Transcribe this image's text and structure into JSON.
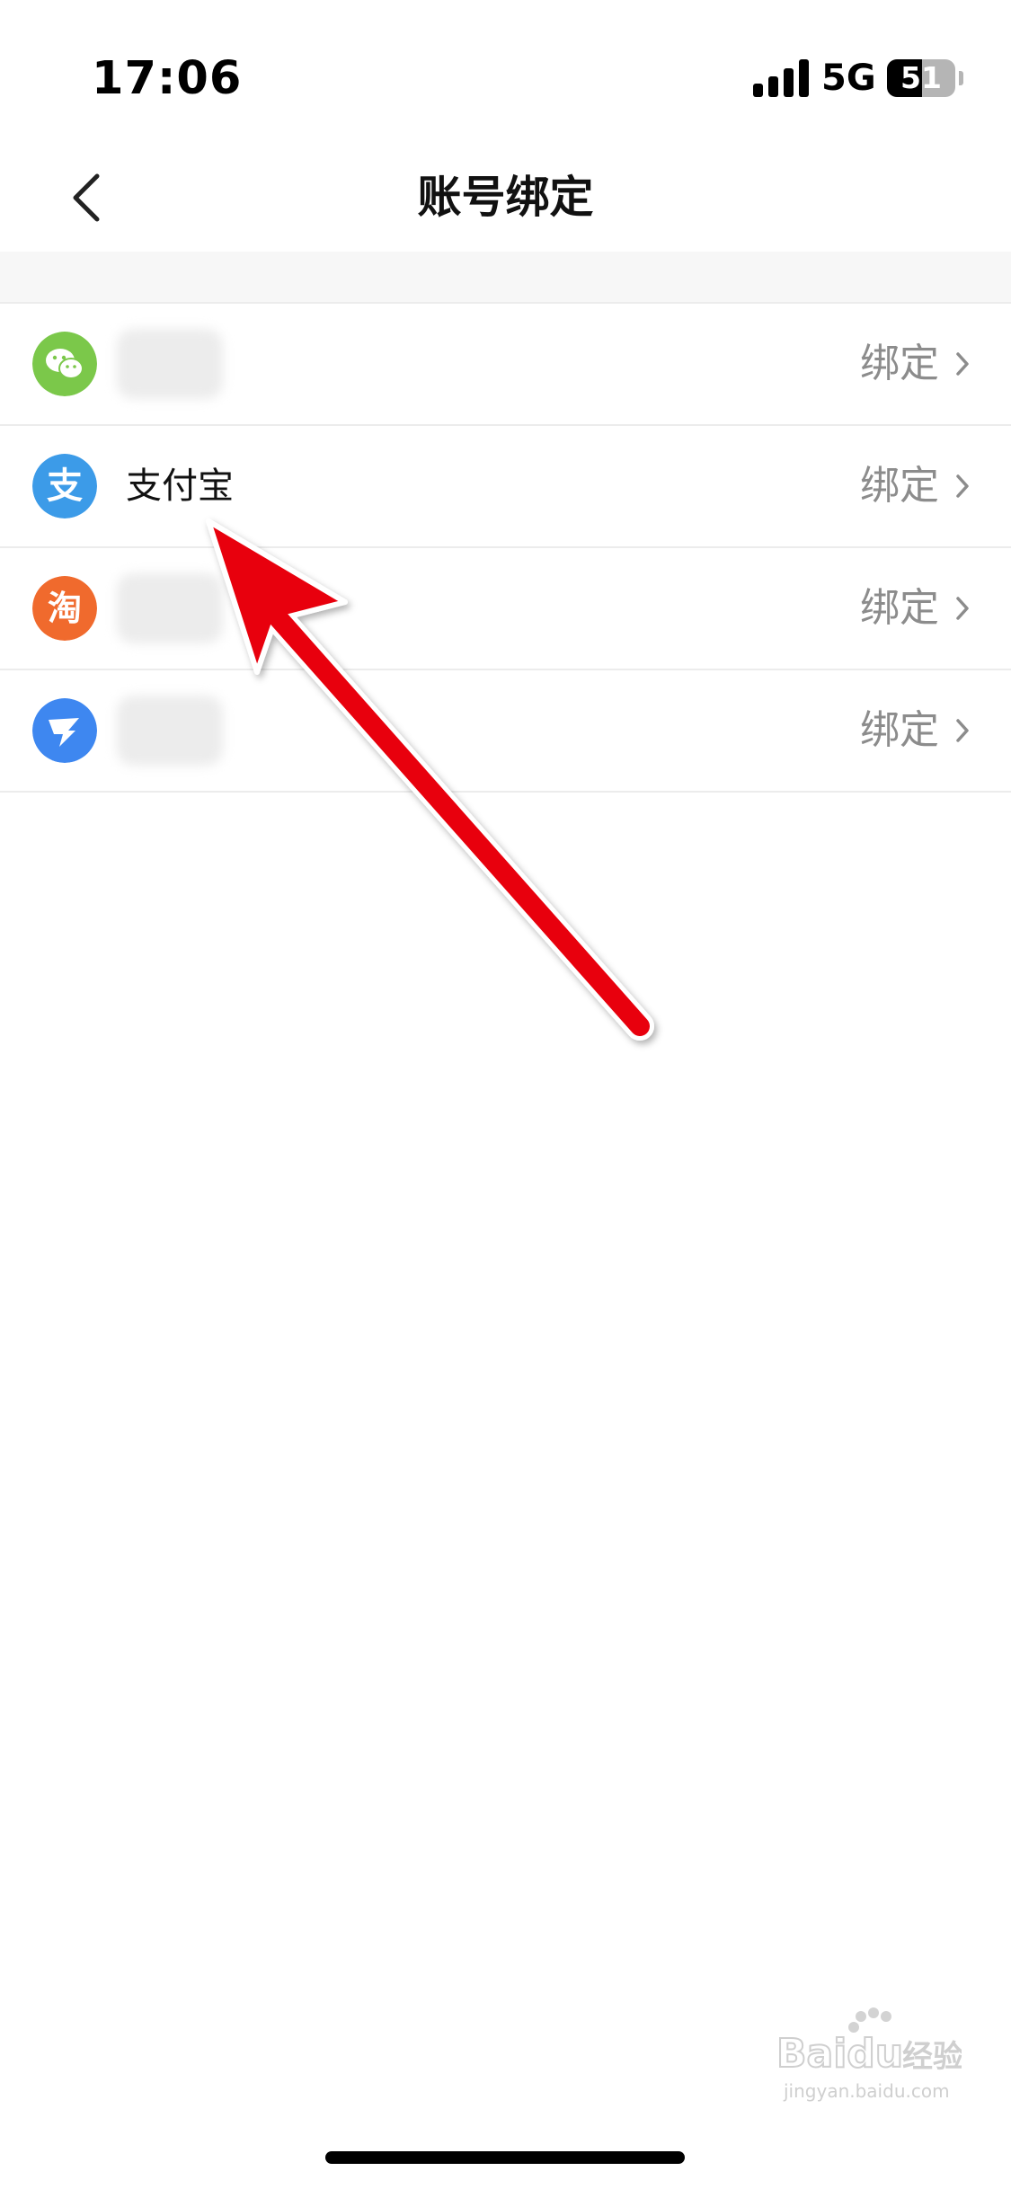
{
  "status_bar": {
    "time": "17:06",
    "network": "5G",
    "battery_level": 51,
    "battery_text": "51"
  },
  "nav": {
    "title": "账号绑定",
    "back_icon": "chevron-left-icon"
  },
  "accounts": [
    {
      "icon": "wechat-icon",
      "icon_color": "#7BC84A",
      "name": "",
      "name_blurred": true,
      "action": "绑定"
    },
    {
      "icon": "alipay-icon",
      "icon_color": "#3C9BE8",
      "name": "支付宝",
      "name_blurred": false,
      "action": "绑定"
    },
    {
      "icon": "taobao-icon",
      "icon_color": "#F06A2D",
      "name": "",
      "name_blurred": true,
      "action": "绑定"
    },
    {
      "icon": "dingtalk-icon",
      "icon_color": "#3E87F0",
      "name": "",
      "name_blurred": true,
      "action": "绑定"
    }
  ],
  "annotation": {
    "type": "arrow",
    "color": "#E8000B",
    "points_to": "alipay-row"
  },
  "watermark": {
    "brand": "Baidu",
    "suffix": "经验",
    "url": "jingyan.baidu.com"
  },
  "colors": {
    "action_text": "#8c8c8c",
    "divider": "#ececec",
    "section_bg": "#f7f7f7"
  }
}
